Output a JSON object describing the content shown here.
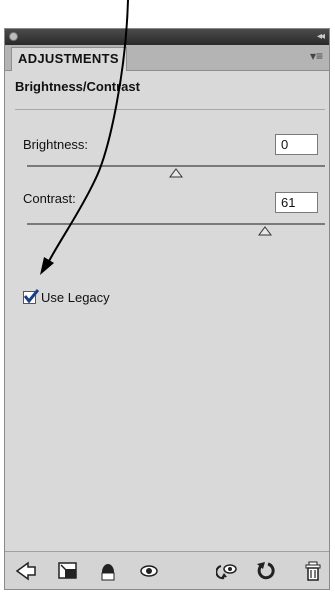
{
  "panel": {
    "tab_label": "ADJUSTMENTS",
    "adjustment_title": "Brightness/Contrast"
  },
  "brightness": {
    "label": "Brightness:",
    "value": "0",
    "slider_fraction": 0.5
  },
  "contrast": {
    "label": "Contrast:",
    "value": "61",
    "slider_fraction": 0.8
  },
  "legacy": {
    "label": "Use Legacy",
    "checked": true
  },
  "colors": {
    "panel_bg": "#d9d9d9",
    "titlebar": "#333333",
    "arrow": "#000000"
  },
  "bottom_toolbar": [
    "back-arrow-icon",
    "expanded-view-icon",
    "clip-to-layer-icon",
    "visibility-eye-icon",
    "view-previous-state-icon",
    "reset-icon",
    "trash-icon"
  ]
}
